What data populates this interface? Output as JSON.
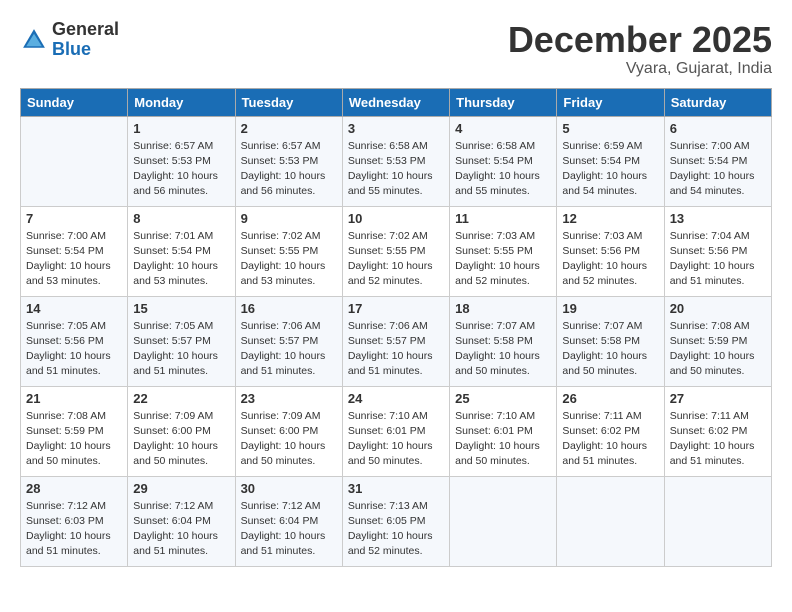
{
  "header": {
    "logo": {
      "line1": "General",
      "line2": "Blue"
    },
    "title": "December 2025",
    "location": "Vyara, Gujarat, India"
  },
  "columns": [
    "Sunday",
    "Monday",
    "Tuesday",
    "Wednesday",
    "Thursday",
    "Friday",
    "Saturday"
  ],
  "weeks": [
    [
      {
        "num": "",
        "info": ""
      },
      {
        "num": "1",
        "info": "Sunrise: 6:57 AM\nSunset: 5:53 PM\nDaylight: 10 hours\nand 56 minutes."
      },
      {
        "num": "2",
        "info": "Sunrise: 6:57 AM\nSunset: 5:53 PM\nDaylight: 10 hours\nand 56 minutes."
      },
      {
        "num": "3",
        "info": "Sunrise: 6:58 AM\nSunset: 5:53 PM\nDaylight: 10 hours\nand 55 minutes."
      },
      {
        "num": "4",
        "info": "Sunrise: 6:58 AM\nSunset: 5:54 PM\nDaylight: 10 hours\nand 55 minutes."
      },
      {
        "num": "5",
        "info": "Sunrise: 6:59 AM\nSunset: 5:54 PM\nDaylight: 10 hours\nand 54 minutes."
      },
      {
        "num": "6",
        "info": "Sunrise: 7:00 AM\nSunset: 5:54 PM\nDaylight: 10 hours\nand 54 minutes."
      }
    ],
    [
      {
        "num": "7",
        "info": "Sunrise: 7:00 AM\nSunset: 5:54 PM\nDaylight: 10 hours\nand 53 minutes."
      },
      {
        "num": "8",
        "info": "Sunrise: 7:01 AM\nSunset: 5:54 PM\nDaylight: 10 hours\nand 53 minutes."
      },
      {
        "num": "9",
        "info": "Sunrise: 7:02 AM\nSunset: 5:55 PM\nDaylight: 10 hours\nand 53 minutes."
      },
      {
        "num": "10",
        "info": "Sunrise: 7:02 AM\nSunset: 5:55 PM\nDaylight: 10 hours\nand 52 minutes."
      },
      {
        "num": "11",
        "info": "Sunrise: 7:03 AM\nSunset: 5:55 PM\nDaylight: 10 hours\nand 52 minutes."
      },
      {
        "num": "12",
        "info": "Sunrise: 7:03 AM\nSunset: 5:56 PM\nDaylight: 10 hours\nand 52 minutes."
      },
      {
        "num": "13",
        "info": "Sunrise: 7:04 AM\nSunset: 5:56 PM\nDaylight: 10 hours\nand 51 minutes."
      }
    ],
    [
      {
        "num": "14",
        "info": "Sunrise: 7:05 AM\nSunset: 5:56 PM\nDaylight: 10 hours\nand 51 minutes."
      },
      {
        "num": "15",
        "info": "Sunrise: 7:05 AM\nSunset: 5:57 PM\nDaylight: 10 hours\nand 51 minutes."
      },
      {
        "num": "16",
        "info": "Sunrise: 7:06 AM\nSunset: 5:57 PM\nDaylight: 10 hours\nand 51 minutes."
      },
      {
        "num": "17",
        "info": "Sunrise: 7:06 AM\nSunset: 5:57 PM\nDaylight: 10 hours\nand 51 minutes."
      },
      {
        "num": "18",
        "info": "Sunrise: 7:07 AM\nSunset: 5:58 PM\nDaylight: 10 hours\nand 50 minutes."
      },
      {
        "num": "19",
        "info": "Sunrise: 7:07 AM\nSunset: 5:58 PM\nDaylight: 10 hours\nand 50 minutes."
      },
      {
        "num": "20",
        "info": "Sunrise: 7:08 AM\nSunset: 5:59 PM\nDaylight: 10 hours\nand 50 minutes."
      }
    ],
    [
      {
        "num": "21",
        "info": "Sunrise: 7:08 AM\nSunset: 5:59 PM\nDaylight: 10 hours\nand 50 minutes."
      },
      {
        "num": "22",
        "info": "Sunrise: 7:09 AM\nSunset: 6:00 PM\nDaylight: 10 hours\nand 50 minutes."
      },
      {
        "num": "23",
        "info": "Sunrise: 7:09 AM\nSunset: 6:00 PM\nDaylight: 10 hours\nand 50 minutes."
      },
      {
        "num": "24",
        "info": "Sunrise: 7:10 AM\nSunset: 6:01 PM\nDaylight: 10 hours\nand 50 minutes."
      },
      {
        "num": "25",
        "info": "Sunrise: 7:10 AM\nSunset: 6:01 PM\nDaylight: 10 hours\nand 50 minutes."
      },
      {
        "num": "26",
        "info": "Sunrise: 7:11 AM\nSunset: 6:02 PM\nDaylight: 10 hours\nand 51 minutes."
      },
      {
        "num": "27",
        "info": "Sunrise: 7:11 AM\nSunset: 6:02 PM\nDaylight: 10 hours\nand 51 minutes."
      }
    ],
    [
      {
        "num": "28",
        "info": "Sunrise: 7:12 AM\nSunset: 6:03 PM\nDaylight: 10 hours\nand 51 minutes."
      },
      {
        "num": "29",
        "info": "Sunrise: 7:12 AM\nSunset: 6:04 PM\nDaylight: 10 hours\nand 51 minutes."
      },
      {
        "num": "30",
        "info": "Sunrise: 7:12 AM\nSunset: 6:04 PM\nDaylight: 10 hours\nand 51 minutes."
      },
      {
        "num": "31",
        "info": "Sunrise: 7:13 AM\nSunset: 6:05 PM\nDaylight: 10 hours\nand 52 minutes."
      },
      {
        "num": "",
        "info": ""
      },
      {
        "num": "",
        "info": ""
      },
      {
        "num": "",
        "info": ""
      }
    ]
  ]
}
